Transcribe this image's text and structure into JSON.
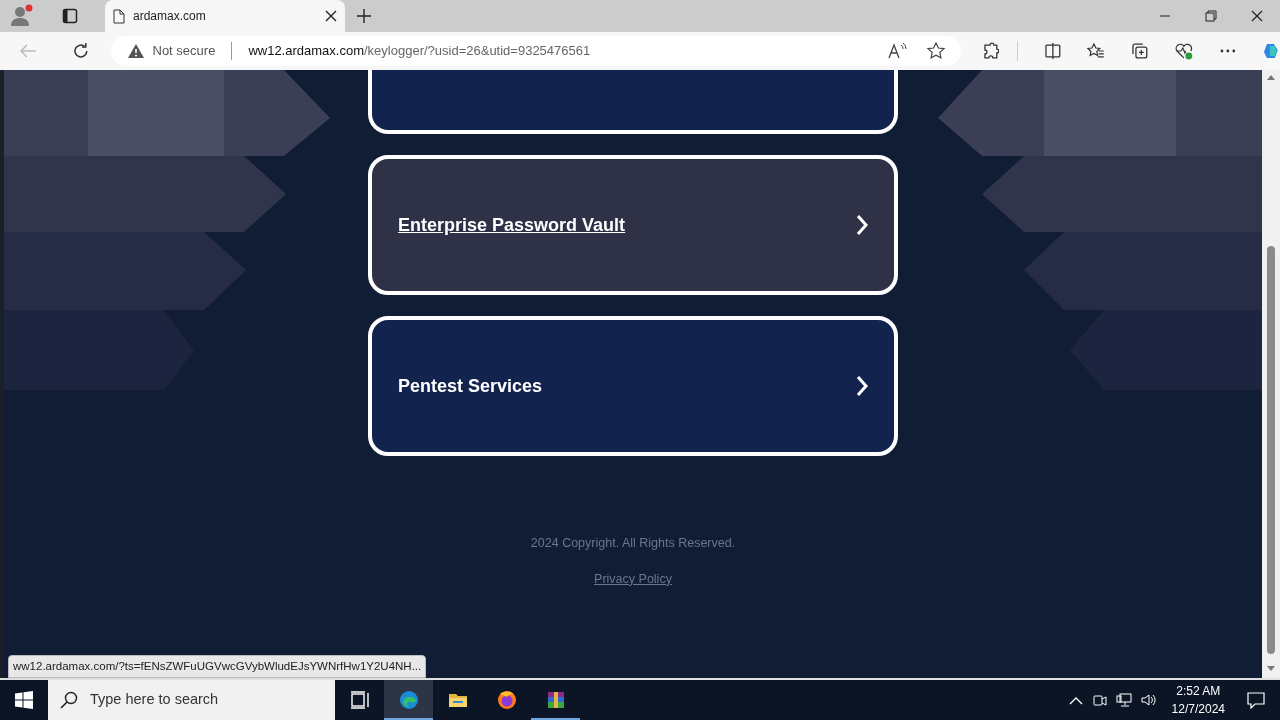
{
  "browser": {
    "tabs": [
      {
        "title": "ardamax.com",
        "selected": true
      }
    ],
    "address_bar": {
      "security": "Not secure",
      "domain": "ww12.ardamax.com",
      "path": "/keylogger/?usid=26&utid=9325476561"
    }
  },
  "page": {
    "cut_card": {
      "hovered": false
    },
    "cards": [
      {
        "title": "Enterprise Password Vault",
        "hovered": true
      },
      {
        "title": "Pentest Services",
        "hovered": false
      }
    ],
    "copyright": "2024 Copyright. All Rights Reserved.",
    "privacy_link": "Privacy Policy"
  },
  "status_url": "ww12.ardamax.com/?ts=fENsZWFuUGVwcGVybWludEJsYWNrfHw1Y2U4NH...",
  "taskbar": {
    "search": {
      "placeholder": "Type here to search"
    },
    "apps": [
      {
        "kind": "taskview",
        "active": false,
        "running": false
      },
      {
        "kind": "edge",
        "active": true,
        "running": true
      },
      {
        "kind": "explorer",
        "active": false,
        "running": false
      },
      {
        "kind": "firefox",
        "active": false,
        "running": false
      },
      {
        "kind": "winrar",
        "active": false,
        "running": true
      }
    ],
    "time": "2:52 AM",
    "date": "12/7/2024"
  }
}
